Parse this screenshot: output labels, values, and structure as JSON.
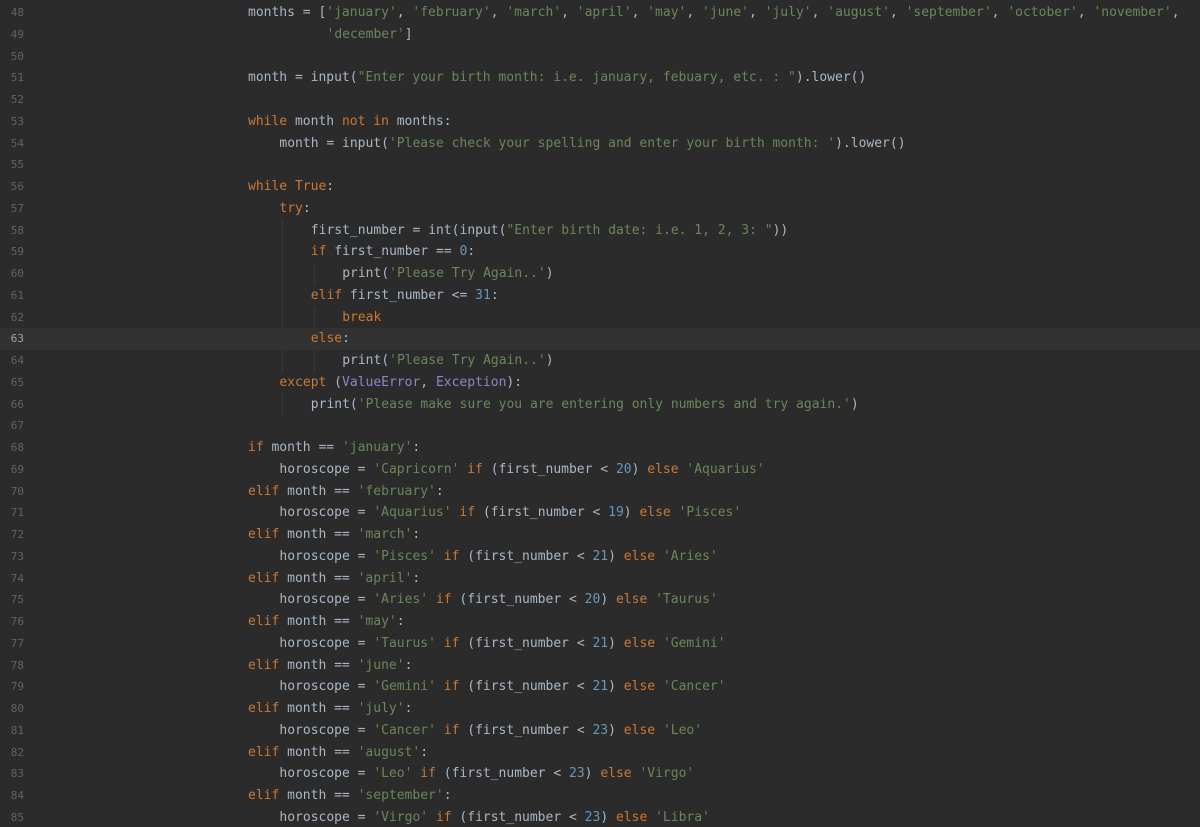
{
  "editor": {
    "current_line": "63",
    "lines": [
      {
        "n": "48",
        "indent": 0,
        "tokens": [
          [
            "t",
            "months = ["
          ],
          [
            "s",
            "'january'"
          ],
          [
            "t",
            ", "
          ],
          [
            "s",
            "'february'"
          ],
          [
            "t",
            ", "
          ],
          [
            "s",
            "'march'"
          ],
          [
            "t",
            ", "
          ],
          [
            "s",
            "'april'"
          ],
          [
            "t",
            ", "
          ],
          [
            "s",
            "'may'"
          ],
          [
            "t",
            ", "
          ],
          [
            "s",
            "'june'"
          ],
          [
            "t",
            ", "
          ],
          [
            "s",
            "'july'"
          ],
          [
            "t",
            ", "
          ],
          [
            "s",
            "'august'"
          ],
          [
            "t",
            ", "
          ],
          [
            "s",
            "'september'"
          ],
          [
            "t",
            ", "
          ],
          [
            "s",
            "'october'"
          ],
          [
            "t",
            ", "
          ],
          [
            "s",
            "'november'"
          ],
          [
            "t",
            ","
          ]
        ]
      },
      {
        "n": "49",
        "indent": 10,
        "tokens": [
          [
            "s",
            "'december'"
          ],
          [
            "t",
            "]"
          ]
        ]
      },
      {
        "n": "50",
        "indent": 0,
        "tokens": []
      },
      {
        "n": "51",
        "indent": 0,
        "tokens": [
          [
            "t",
            "month = input("
          ],
          [
            "s",
            "\"Enter your birth month: i.e. january, febuary, etc. : \""
          ],
          [
            "t",
            ").lower()"
          ]
        ]
      },
      {
        "n": "52",
        "indent": 0,
        "tokens": []
      },
      {
        "n": "53",
        "indent": 0,
        "tokens": [
          [
            "k",
            "while"
          ],
          [
            "t",
            " month "
          ],
          [
            "k",
            "not in"
          ],
          [
            "t",
            " months:"
          ]
        ]
      },
      {
        "n": "54",
        "indent": 4,
        "tokens": [
          [
            "t",
            "month = input("
          ],
          [
            "s",
            "'Please check your spelling and enter your birth month: '"
          ],
          [
            "t",
            ").lower()"
          ]
        ]
      },
      {
        "n": "55",
        "indent": 0,
        "tokens": []
      },
      {
        "n": "56",
        "indent": 0,
        "tokens": [
          [
            "k",
            "while True"
          ],
          [
            "t",
            ":"
          ]
        ]
      },
      {
        "n": "57",
        "indent": 4,
        "tokens": [
          [
            "k",
            "try"
          ],
          [
            "t",
            ":"
          ]
        ]
      },
      {
        "n": "58",
        "indent": 8,
        "tokens": [
          [
            "t",
            "first_number = int(input("
          ],
          [
            "s",
            "\"Enter birth date: i.e. 1, 2, 3: \""
          ],
          [
            "t",
            "))"
          ]
        ]
      },
      {
        "n": "59",
        "indent": 8,
        "tokens": [
          [
            "k",
            "if"
          ],
          [
            "t",
            " first_number == "
          ],
          [
            "n",
            "0"
          ],
          [
            "t",
            ":"
          ]
        ]
      },
      {
        "n": "60",
        "indent": 12,
        "tokens": [
          [
            "t",
            "print("
          ],
          [
            "s",
            "'Please Try Again..'"
          ],
          [
            "t",
            ")"
          ]
        ]
      },
      {
        "n": "61",
        "indent": 8,
        "tokens": [
          [
            "k",
            "elif"
          ],
          [
            "t",
            " first_number <= "
          ],
          [
            "n",
            "31"
          ],
          [
            "t",
            ":"
          ]
        ]
      },
      {
        "n": "62",
        "indent": 12,
        "tokens": [
          [
            "k",
            "break"
          ]
        ]
      },
      {
        "n": "63",
        "indent": 8,
        "tokens": [
          [
            "k",
            "else"
          ],
          [
            "t",
            ":"
          ]
        ]
      },
      {
        "n": "64",
        "indent": 12,
        "tokens": [
          [
            "t",
            "print("
          ],
          [
            "s",
            "'Please Try Again..'"
          ],
          [
            "t",
            ")"
          ]
        ]
      },
      {
        "n": "65",
        "indent": 4,
        "tokens": [
          [
            "k",
            "except"
          ],
          [
            "t",
            " ("
          ],
          [
            "c",
            "ValueError"
          ],
          [
            "t",
            ", "
          ],
          [
            "c",
            "Exception"
          ],
          [
            "t",
            "):"
          ]
        ]
      },
      {
        "n": "66",
        "indent": 8,
        "tokens": [
          [
            "t",
            "print("
          ],
          [
            "s",
            "'Please make sure you are entering only numbers and try again.'"
          ],
          [
            "t",
            ")"
          ]
        ]
      },
      {
        "n": "67",
        "indent": 0,
        "tokens": []
      },
      {
        "n": "68",
        "indent": 0,
        "tokens": [
          [
            "k",
            "if"
          ],
          [
            "t",
            " month == "
          ],
          [
            "s",
            "'january'"
          ],
          [
            "t",
            ":"
          ]
        ]
      },
      {
        "n": "69",
        "indent": 4,
        "tokens": [
          [
            "t",
            "horoscope = "
          ],
          [
            "s",
            "'Capricorn'"
          ],
          [
            "t",
            " "
          ],
          [
            "k",
            "if"
          ],
          [
            "t",
            " (first_number < "
          ],
          [
            "n",
            "20"
          ],
          [
            "t",
            ") "
          ],
          [
            "k",
            "else"
          ],
          [
            "t",
            " "
          ],
          [
            "s",
            "'Aquarius'"
          ]
        ]
      },
      {
        "n": "70",
        "indent": 0,
        "tokens": [
          [
            "k",
            "elif"
          ],
          [
            "t",
            " month == "
          ],
          [
            "s",
            "'february'"
          ],
          [
            "t",
            ":"
          ]
        ]
      },
      {
        "n": "71",
        "indent": 4,
        "tokens": [
          [
            "t",
            "horoscope = "
          ],
          [
            "s",
            "'Aquarius'"
          ],
          [
            "t",
            " "
          ],
          [
            "k",
            "if"
          ],
          [
            "t",
            " (first_number < "
          ],
          [
            "n",
            "19"
          ],
          [
            "t",
            ") "
          ],
          [
            "k",
            "else"
          ],
          [
            "t",
            " "
          ],
          [
            "s",
            "'Pisces'"
          ]
        ]
      },
      {
        "n": "72",
        "indent": 0,
        "tokens": [
          [
            "k",
            "elif"
          ],
          [
            "t",
            " month == "
          ],
          [
            "s",
            "'march'"
          ],
          [
            "t",
            ":"
          ]
        ]
      },
      {
        "n": "73",
        "indent": 4,
        "tokens": [
          [
            "t",
            "horoscope = "
          ],
          [
            "s",
            "'Pisces'"
          ],
          [
            "t",
            " "
          ],
          [
            "k",
            "if"
          ],
          [
            "t",
            " (first_number < "
          ],
          [
            "n",
            "21"
          ],
          [
            "t",
            ") "
          ],
          [
            "k",
            "else"
          ],
          [
            "t",
            " "
          ],
          [
            "s",
            "'Aries'"
          ]
        ]
      },
      {
        "n": "74",
        "indent": 0,
        "tokens": [
          [
            "k",
            "elif"
          ],
          [
            "t",
            " month == "
          ],
          [
            "s",
            "'april'"
          ],
          [
            "t",
            ":"
          ]
        ]
      },
      {
        "n": "75",
        "indent": 4,
        "tokens": [
          [
            "t",
            "horoscope = "
          ],
          [
            "s",
            "'Aries'"
          ],
          [
            "t",
            " "
          ],
          [
            "k",
            "if"
          ],
          [
            "t",
            " (first_number < "
          ],
          [
            "n",
            "20"
          ],
          [
            "t",
            ") "
          ],
          [
            "k",
            "else"
          ],
          [
            "t",
            " "
          ],
          [
            "s",
            "'Taurus'"
          ]
        ]
      },
      {
        "n": "76",
        "indent": 0,
        "tokens": [
          [
            "k",
            "elif"
          ],
          [
            "t",
            " month == "
          ],
          [
            "s",
            "'may'"
          ],
          [
            "t",
            ":"
          ]
        ]
      },
      {
        "n": "77",
        "indent": 4,
        "tokens": [
          [
            "t",
            "horoscope = "
          ],
          [
            "s",
            "'Taurus'"
          ],
          [
            "t",
            " "
          ],
          [
            "k",
            "if"
          ],
          [
            "t",
            " (first_number < "
          ],
          [
            "n",
            "21"
          ],
          [
            "t",
            ") "
          ],
          [
            "k",
            "else"
          ],
          [
            "t",
            " "
          ],
          [
            "s",
            "'Gemini'"
          ]
        ]
      },
      {
        "n": "78",
        "indent": 0,
        "tokens": [
          [
            "k",
            "elif"
          ],
          [
            "t",
            " month == "
          ],
          [
            "s",
            "'june'"
          ],
          [
            "t",
            ":"
          ]
        ]
      },
      {
        "n": "79",
        "indent": 4,
        "tokens": [
          [
            "t",
            "horoscope = "
          ],
          [
            "s",
            "'Gemini'"
          ],
          [
            "t",
            " "
          ],
          [
            "k",
            "if"
          ],
          [
            "t",
            " (first_number < "
          ],
          [
            "n",
            "21"
          ],
          [
            "t",
            ") "
          ],
          [
            "k",
            "else"
          ],
          [
            "t",
            " "
          ],
          [
            "s",
            "'Cancer'"
          ]
        ]
      },
      {
        "n": "80",
        "indent": 0,
        "tokens": [
          [
            "k",
            "elif"
          ],
          [
            "t",
            " month == "
          ],
          [
            "s",
            "'july'"
          ],
          [
            "t",
            ":"
          ]
        ]
      },
      {
        "n": "81",
        "indent": 4,
        "tokens": [
          [
            "t",
            "horoscope = "
          ],
          [
            "s",
            "'Cancer'"
          ],
          [
            "t",
            " "
          ],
          [
            "k",
            "if"
          ],
          [
            "t",
            " (first_number < "
          ],
          [
            "n",
            "23"
          ],
          [
            "t",
            ") "
          ],
          [
            "k",
            "else"
          ],
          [
            "t",
            " "
          ],
          [
            "s",
            "'Leo'"
          ]
        ]
      },
      {
        "n": "82",
        "indent": 0,
        "tokens": [
          [
            "k",
            "elif"
          ],
          [
            "t",
            " month == "
          ],
          [
            "s",
            "'august'"
          ],
          [
            "t",
            ":"
          ]
        ]
      },
      {
        "n": "83",
        "indent": 4,
        "tokens": [
          [
            "t",
            "horoscope = "
          ],
          [
            "s",
            "'Leo'"
          ],
          [
            "t",
            " "
          ],
          [
            "k",
            "if"
          ],
          [
            "t",
            " (first_number < "
          ],
          [
            "n",
            "23"
          ],
          [
            "t",
            ") "
          ],
          [
            "k",
            "else"
          ],
          [
            "t",
            " "
          ],
          [
            "s",
            "'Virgo'"
          ]
        ]
      },
      {
        "n": "84",
        "indent": 0,
        "tokens": [
          [
            "k",
            "elif"
          ],
          [
            "t",
            " month == "
          ],
          [
            "s",
            "'september'"
          ],
          [
            "t",
            ":"
          ]
        ]
      },
      {
        "n": "85",
        "indent": 4,
        "tokens": [
          [
            "t",
            "horoscope = "
          ],
          [
            "s",
            "'Virgo'"
          ],
          [
            "t",
            " "
          ],
          [
            "k",
            "if"
          ],
          [
            "t",
            " (first_number < "
          ],
          [
            "n",
            "23"
          ],
          [
            "t",
            ") "
          ],
          [
            "k",
            "else"
          ],
          [
            "t",
            " "
          ],
          [
            "s",
            "'Libra'"
          ]
        ]
      }
    ]
  }
}
